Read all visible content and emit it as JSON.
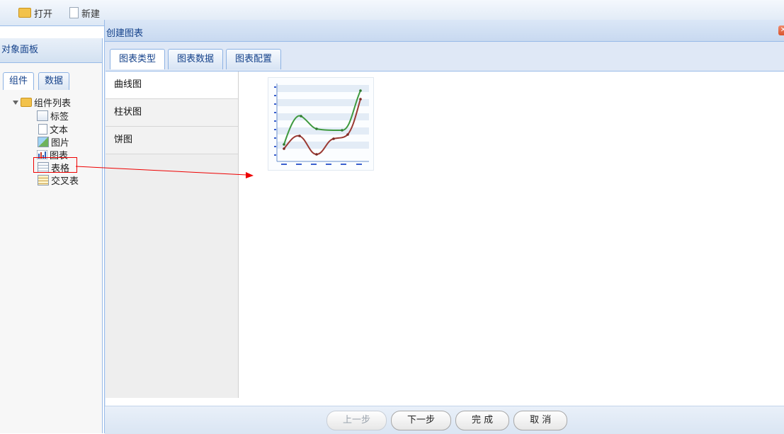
{
  "toolbar": {
    "open_label": "打开",
    "new_label": "新建"
  },
  "object_panel": {
    "title": "对象面板",
    "tabs": [
      "组件",
      "数据"
    ],
    "tree": {
      "root_label": "组件列表",
      "items": [
        {
          "label": "标签",
          "icon": "label-icon"
        },
        {
          "label": "文本",
          "icon": "text-icon"
        },
        {
          "label": "图片",
          "icon": "image-icon"
        },
        {
          "label": "图表",
          "icon": "chart-icon"
        },
        {
          "label": "表格",
          "icon": "table-icon"
        },
        {
          "label": "交叉表",
          "icon": "crosstab-icon"
        }
      ]
    }
  },
  "dialog": {
    "title": "创建图表",
    "tabs": [
      "图表类型",
      "图表数据",
      "图表配置"
    ],
    "active_tab": "图表类型",
    "chart_types": [
      "曲线图",
      "柱状图",
      "饼图"
    ],
    "selected_type": "曲线图",
    "buttons": {
      "prev": "上一步",
      "next": "下一步",
      "finish": "完 成",
      "cancel": "取 消"
    }
  },
  "colors": {
    "accent_border": "#99bbe8",
    "header_text": "#15428b",
    "highlight": "#ee0000",
    "preview_line_green": "#3f9a3f",
    "preview_line_red": "#9b3a33"
  }
}
